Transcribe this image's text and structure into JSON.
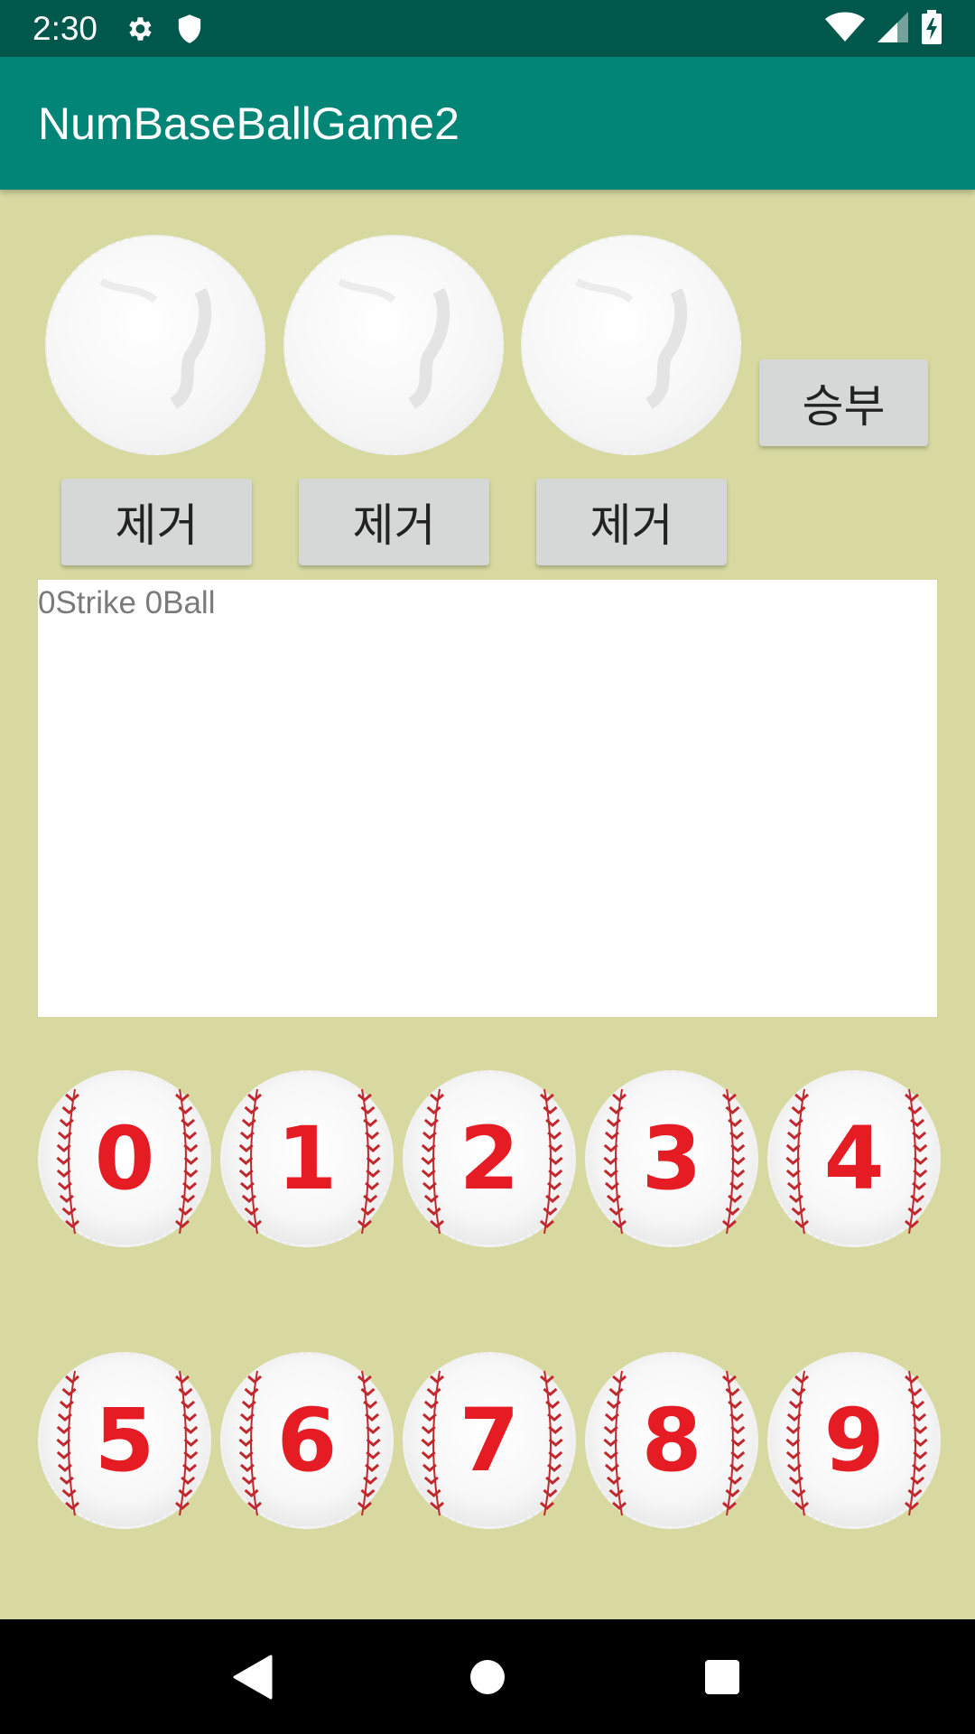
{
  "status_bar": {
    "time": "2:30",
    "left_icons": [
      "gear-icon",
      "shield-icon"
    ],
    "right_icons": [
      "wifi-icon",
      "signal-icon",
      "battery-icon"
    ]
  },
  "app_bar": {
    "title": "NumBaseBallGame2"
  },
  "slots": {
    "remove_labels": [
      "제거",
      "제거",
      "제거"
    ],
    "submit_label": "승부"
  },
  "result": {
    "text": "0Strike 0Ball"
  },
  "number_balls": {
    "row1": [
      "0",
      "1",
      "2",
      "3",
      "4"
    ],
    "row2": [
      "5",
      "6",
      "7",
      "8",
      "9"
    ]
  },
  "colors": {
    "status_bar": "#00574b",
    "app_bar": "#008577",
    "background": "#d7d9a1",
    "number": "#e61c24",
    "stitch": "#c0282d"
  },
  "nav_bar": {
    "icons": [
      "back-icon",
      "home-icon",
      "recents-icon"
    ]
  }
}
